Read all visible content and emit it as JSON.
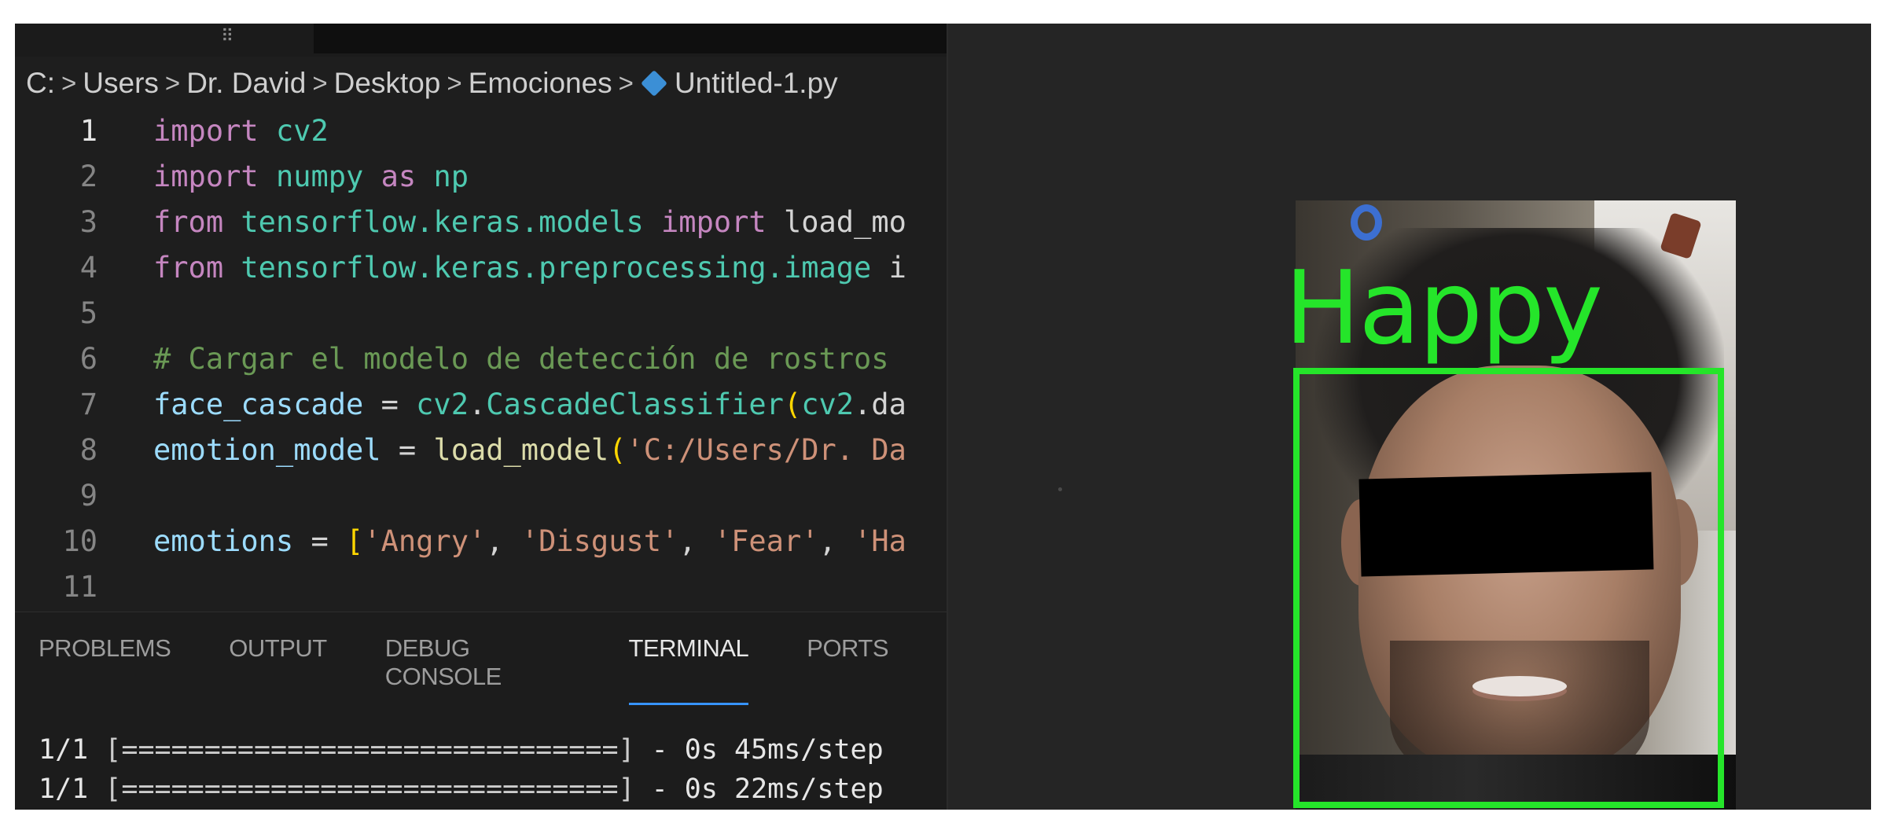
{
  "breadcrumb": {
    "items": [
      "C:",
      "Users",
      "Dr. David",
      "Desktop",
      "Emociones"
    ],
    "file": "Untitled-1.py",
    "separator": ">"
  },
  "editor": {
    "lines": [
      {
        "num": "1",
        "parts": [
          [
            "kw",
            "import"
          ],
          [
            "op",
            " "
          ],
          [
            "mod",
            "cv2"
          ]
        ]
      },
      {
        "num": "2",
        "parts": [
          [
            "kw",
            "import"
          ],
          [
            "op",
            " "
          ],
          [
            "mod",
            "numpy"
          ],
          [
            "op",
            " "
          ],
          [
            "kw",
            "as"
          ],
          [
            "op",
            " "
          ],
          [
            "mod",
            "np"
          ]
        ]
      },
      {
        "num": "3",
        "parts": [
          [
            "kw",
            "from"
          ],
          [
            "op",
            " "
          ],
          [
            "mod",
            "tensorflow.keras.models"
          ],
          [
            "op",
            " "
          ],
          [
            "kw",
            "import"
          ],
          [
            "op",
            " load_mo"
          ]
        ]
      },
      {
        "num": "4",
        "parts": [
          [
            "kw",
            "from"
          ],
          [
            "op",
            " "
          ],
          [
            "mod",
            "tensorflow.keras.preprocessing.image"
          ],
          [
            "op",
            " i"
          ]
        ]
      },
      {
        "num": "5",
        "parts": []
      },
      {
        "num": "6",
        "parts": [
          [
            "cmt",
            "# Cargar el modelo de detección de rostros"
          ]
        ]
      },
      {
        "num": "7",
        "parts": [
          [
            "var",
            "face_cascade"
          ],
          [
            "op",
            " = "
          ],
          [
            "mod",
            "cv2"
          ],
          [
            "op",
            "."
          ],
          [
            "cls",
            "CascadeClassifier"
          ],
          [
            "brk",
            "("
          ],
          [
            "mod",
            "cv2"
          ],
          [
            "op",
            ".da"
          ]
        ]
      },
      {
        "num": "8",
        "parts": [
          [
            "var",
            "emotion_model"
          ],
          [
            "op",
            " = "
          ],
          [
            "fn",
            "load_model"
          ],
          [
            "brk",
            "("
          ],
          [
            "str",
            "'C:/Users/Dr. Da"
          ]
        ]
      },
      {
        "num": "9",
        "parts": []
      },
      {
        "num": "10",
        "parts": [
          [
            "var",
            "emotions"
          ],
          [
            "op",
            " = "
          ],
          [
            "brk",
            "["
          ],
          [
            "str",
            "'Angry'"
          ],
          [
            "op",
            ", "
          ],
          [
            "str",
            "'Disgust'"
          ],
          [
            "op",
            ", "
          ],
          [
            "str",
            "'Fear'"
          ],
          [
            "op",
            ", "
          ],
          [
            "str",
            "'Ha"
          ]
        ]
      },
      {
        "num": "11",
        "parts": []
      }
    ]
  },
  "panel": {
    "tabs": [
      {
        "label": "PROBLEMS",
        "active": false
      },
      {
        "label": "OUTPUT",
        "active": false
      },
      {
        "label": "DEBUG CONSOLE",
        "active": false
      },
      {
        "label": "TERMINAL",
        "active": true
      },
      {
        "label": "PORTS",
        "active": false
      }
    ],
    "terminal_lines": [
      {
        "prefix": "1/1",
        "bar": "[==============================]",
        "suffix": " - 0s 45ms/step"
      },
      {
        "prefix": "1/1",
        "bar": "[==============================]",
        "suffix": " - 0s 22ms/step"
      }
    ]
  },
  "camera": {
    "emotion_label": "Happy",
    "box_color": "#25e52a"
  },
  "colors": {
    "editor_bg": "#1e1e1e",
    "keyword": "#c586c0",
    "module": "#4ec9b0",
    "comment": "#6a9955",
    "variable": "#9cdcfe",
    "string": "#ce9178",
    "active_tab_underline": "#3794ff"
  }
}
